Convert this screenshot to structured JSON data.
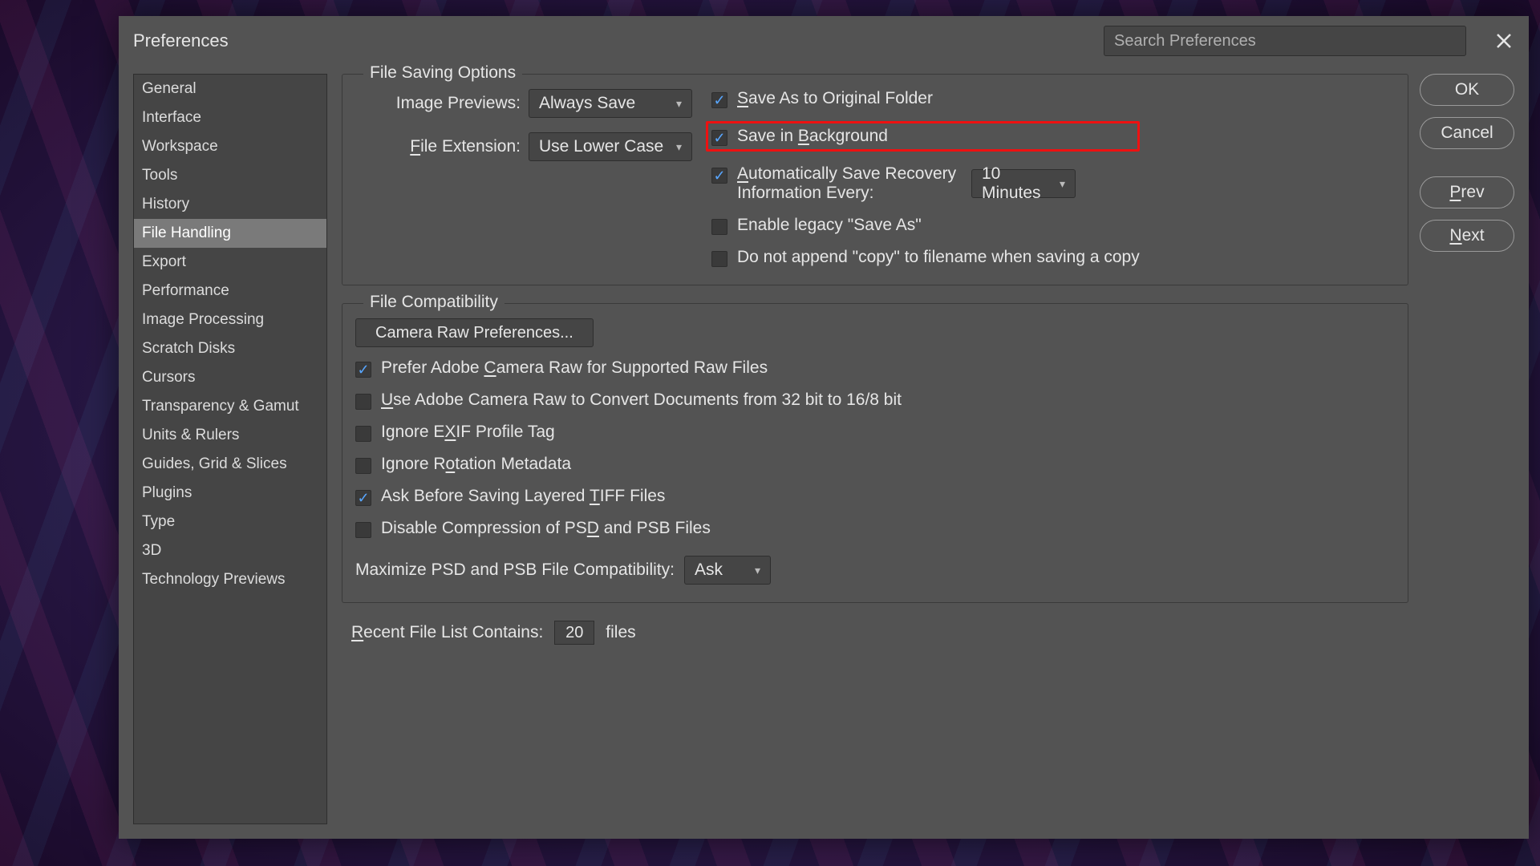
{
  "window": {
    "title": "Preferences",
    "search_placeholder": "Search Preferences"
  },
  "sidebar": {
    "items": [
      {
        "label": "General"
      },
      {
        "label": "Interface"
      },
      {
        "label": "Workspace"
      },
      {
        "label": "Tools"
      },
      {
        "label": "History"
      },
      {
        "label": "File Handling",
        "selected": true
      },
      {
        "label": "Export"
      },
      {
        "label": "Performance"
      },
      {
        "label": "Image Processing"
      },
      {
        "label": "Scratch Disks"
      },
      {
        "label": "Cursors"
      },
      {
        "label": "Transparency & Gamut"
      },
      {
        "label": "Units & Rulers"
      },
      {
        "label": "Guides, Grid & Slices"
      },
      {
        "label": "Plugins"
      },
      {
        "label": "Type"
      },
      {
        "label": "3D"
      },
      {
        "label": "Technology Previews"
      }
    ]
  },
  "saving": {
    "legend": "File Saving Options",
    "image_previews_label": "Image Previews:",
    "image_previews_value": "Always Save",
    "file_ext_label": "File Extension:",
    "file_ext_value": "Use Lower Case",
    "save_as_original": "Save As to Original Folder",
    "save_in_background": "Save in Background",
    "auto_recovery": "Automatically Save Recovery Information Every:",
    "auto_recovery_value": "10 Minutes",
    "legacy_save_as": "Enable legacy \"Save As\"",
    "no_copy_append": "Do not append \"copy\" to filename when saving a copy"
  },
  "compat": {
    "legend": "File Compatibility",
    "camera_raw_btn": "Camera Raw Preferences...",
    "prefer_acr": "Prefer Adobe Camera Raw for Supported Raw Files",
    "use_acr_32": "Use Adobe Camera Raw to Convert Documents from 32 bit to 16/8 bit",
    "ignore_exif": "Ignore EXIF Profile Tag",
    "ignore_rotation": "Ignore Rotation Metadata",
    "ask_tiff": "Ask Before Saving Layered TIFF Files",
    "disable_psd_comp": "Disable Compression of PSD and PSB Files",
    "max_label": "Maximize PSD and PSB File Compatibility:",
    "max_value": "Ask"
  },
  "recent": {
    "label": "Recent File List Contains:",
    "value": "20",
    "suffix": "files"
  },
  "buttons": {
    "ok": "OK",
    "cancel": "Cancel",
    "prev": "Prev",
    "next": "Next"
  }
}
